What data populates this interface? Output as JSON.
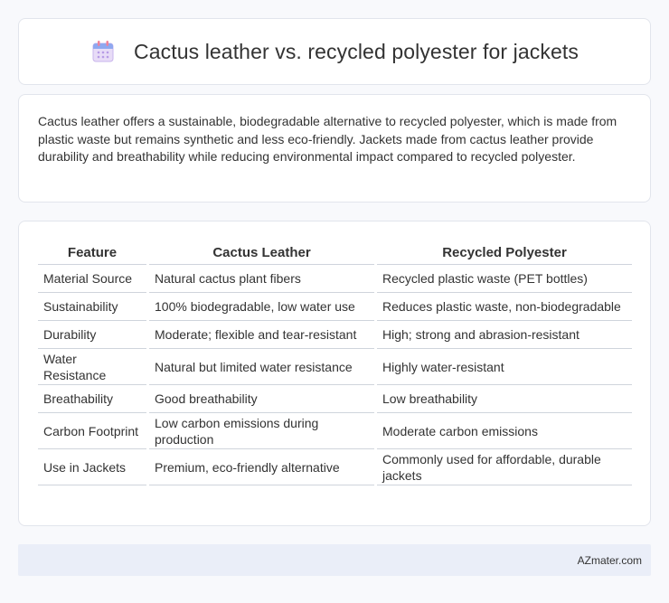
{
  "header": {
    "title": "Cactus leather vs. recycled polyester for jackets",
    "icon": "calendar-icon"
  },
  "summary": {
    "text": "Cactus leather offers a sustainable, biodegradable alternative to recycled polyester, which is made from plastic waste but remains synthetic and less eco-friendly. Jackets made from cactus leather provide durability and breathability while reducing environmental impact compared to recycled polyester."
  },
  "table": {
    "headers": [
      "Feature",
      "Cactus Leather",
      "Recycled Polyester"
    ],
    "rows": [
      [
        "Material Source",
        "Natural cactus plant fibers",
        "Recycled plastic waste (PET bottles)"
      ],
      [
        "Sustainability",
        "100% biodegradable, low water use",
        "Reduces plastic waste, non-biodegradable"
      ],
      [
        "Durability",
        "Moderate; flexible and tear-resistant",
        "High; strong and abrasion-resistant"
      ],
      [
        "Water Resistance",
        "Natural but limited water resistance",
        "Highly water-resistant"
      ],
      [
        "Breathability",
        "Good breathability",
        "Low breathability"
      ],
      [
        "Carbon Footprint",
        "Low carbon emissions during production",
        "Moderate carbon emissions"
      ],
      [
        "Use in Jackets",
        "Premium, eco-friendly alternative",
        "Commonly used for affordable, durable jackets"
      ]
    ]
  },
  "footer": {
    "text": "AZmater.com"
  }
}
